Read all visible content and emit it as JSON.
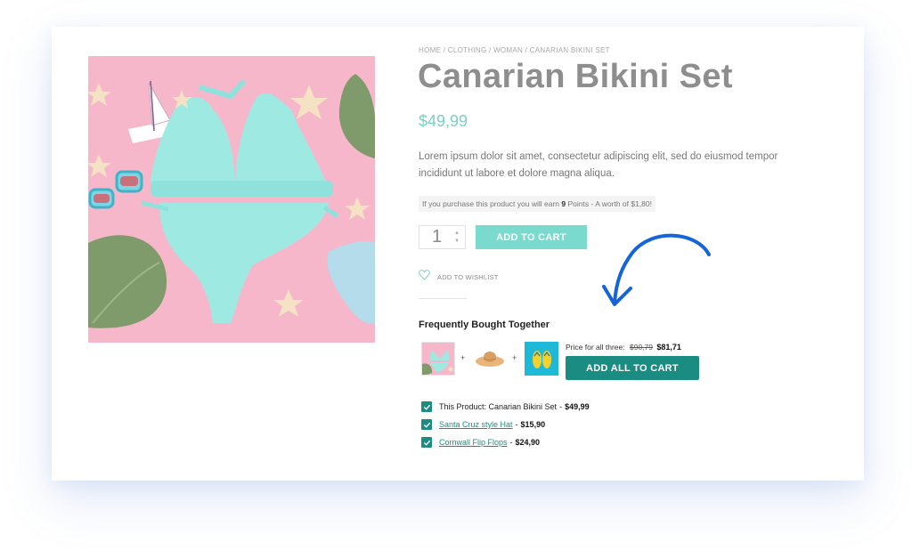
{
  "breadcrumb": "HOME / CLOTHING / WOMAN / CANARIAN BIKINI SET",
  "product": {
    "title": "Canarian Bikini Set",
    "price": "$49,99",
    "description": "Lorem ipsum dolor sit amet, consectetur adipiscing elit, sed do eiusmod tempor incididunt ut labore et dolore magna aliqua."
  },
  "points": {
    "prefix": "If you purchase this product you will earn ",
    "count": "9",
    "suffix": " Points - A worth of $1,80!"
  },
  "quantity": {
    "value": "1"
  },
  "buttons": {
    "add_to_cart": "ADD TO CART",
    "add_all_to_cart": "ADD ALL TO CART"
  },
  "wishlist": {
    "label": "ADD TO WISHLIST",
    "icon": "heart-icon"
  },
  "fbt": {
    "title": "Frequently Bought Together",
    "plus": "+",
    "price_label": "Price for all three:",
    "old_price": "$90,79",
    "new_price": "$81,71",
    "items": [
      {
        "label": "This Product: Canarian Bikini Set",
        "separator": "-",
        "price": "$49,99",
        "checked": true,
        "link": false
      },
      {
        "label": "Santa Cruz style Hat ",
        "separator": "-",
        "price": "$15,90",
        "checked": true,
        "link": true
      },
      {
        "label": "Cornwall Flip Flops ",
        "separator": "-",
        "price": "$24,90",
        "checked": true,
        "link": true
      }
    ]
  },
  "colors": {
    "accent_light": "#79dacd",
    "accent_dark": "#1a8c82",
    "price": "#7ccfc6",
    "annotation_arrow": "#1565d8"
  }
}
